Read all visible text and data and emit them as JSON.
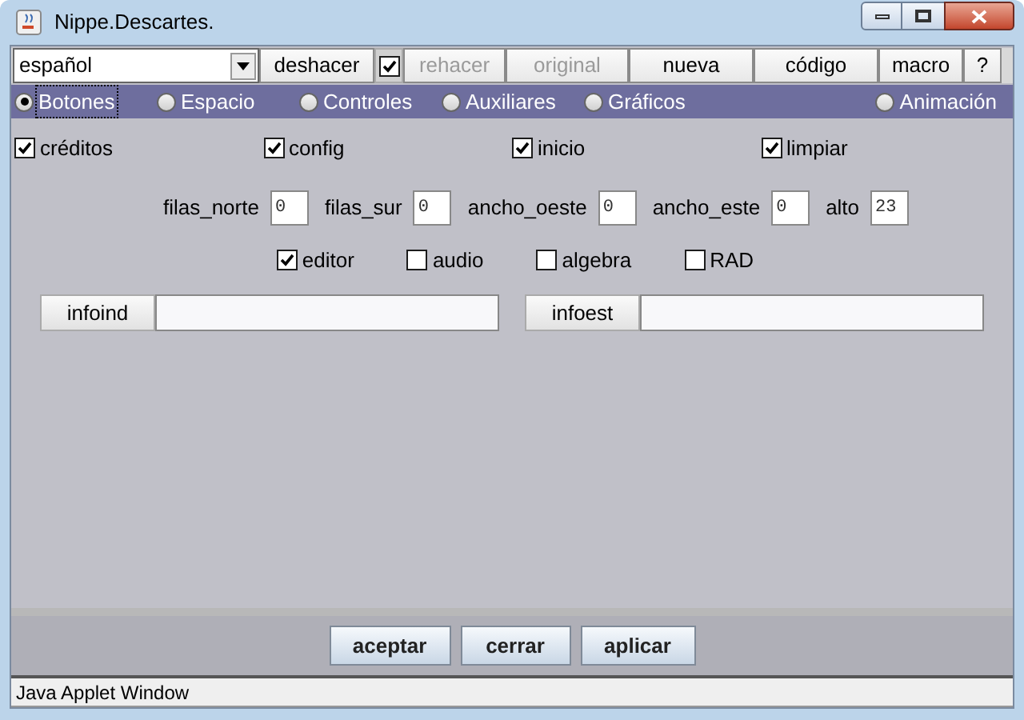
{
  "window": {
    "title": "Nippe.Descartes."
  },
  "toolbar": {
    "language": "español",
    "items": [
      {
        "kind": "button",
        "label": "deshacer",
        "disabled": false
      },
      {
        "kind": "checkbox",
        "checked": true
      },
      {
        "kind": "button",
        "label": "rehacer",
        "disabled": true
      },
      {
        "kind": "button",
        "label": "original",
        "disabled": true
      },
      {
        "kind": "button",
        "label": "nueva",
        "disabled": false
      },
      {
        "kind": "button",
        "label": "código",
        "disabled": false
      },
      {
        "kind": "button",
        "label": "macro",
        "disabled": false
      },
      {
        "kind": "button",
        "label": "?",
        "disabled": false
      }
    ]
  },
  "tabs": [
    {
      "label": "Botones",
      "selected": true
    },
    {
      "label": "Espacio",
      "selected": false
    },
    {
      "label": "Controles",
      "selected": false
    },
    {
      "label": "Auxiliares",
      "selected": false
    },
    {
      "label": "Gráficos",
      "selected": false
    },
    {
      "label": "Animación",
      "selected": false
    }
  ],
  "options": [
    {
      "label": "créditos",
      "checked": true
    },
    {
      "label": "config",
      "checked": true
    },
    {
      "label": "inicio",
      "checked": true
    },
    {
      "label": "limpiar",
      "checked": true
    }
  ],
  "fields": [
    {
      "label": "filas_norte",
      "value": "0"
    },
    {
      "label": "filas_sur",
      "value": "0"
    },
    {
      "label": "ancho_oeste",
      "value": "0"
    },
    {
      "label": "ancho_este",
      "value": "0"
    },
    {
      "label": "alto",
      "value": "23"
    }
  ],
  "extras": [
    {
      "label": "editor",
      "checked": true
    },
    {
      "label": "audio",
      "checked": false
    },
    {
      "label": "algebra",
      "checked": false
    },
    {
      "label": "RAD",
      "checked": false
    }
  ],
  "info": [
    {
      "label": "infoind"
    },
    {
      "label": "infoest"
    }
  ],
  "actions": [
    "aceptar",
    "cerrar",
    "aplicar"
  ],
  "status_bar": "Java Applet Window"
}
